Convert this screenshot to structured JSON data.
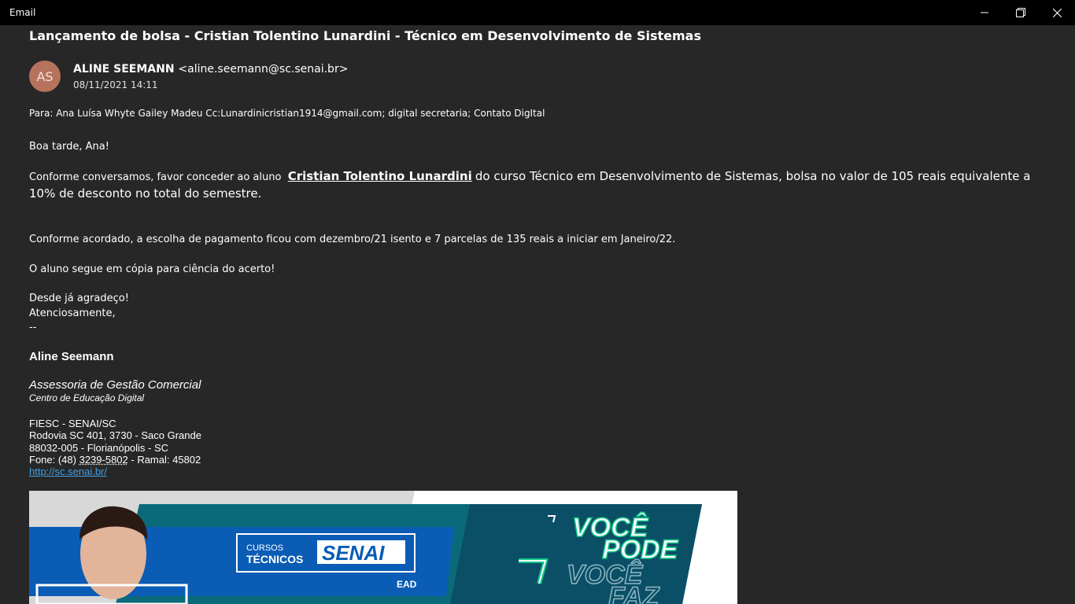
{
  "window": {
    "title": "Email",
    "controls": [
      "minimize-icon",
      "restore-icon",
      "close-icon"
    ]
  },
  "email": {
    "subject": "Lançamento de bolsa - Cristian Tolentino Lunardini - Técnico em Desenvolvimento de Sistemas",
    "avatar_initials": "AS",
    "avatar_color": "#b5735e",
    "sender_name": "ALINE SEEMANN",
    "sender_address": "<aline.seemann@sc.senai.br>",
    "date": "08/11/2021 14:11",
    "recipients": "Para: Ana Luísa Whyte Gailey Madeu Cc:Lunardinicristian1914@gmail.com; digital secretaria; Contato DigItal",
    "greeting": "Boa tarde, Ana!",
    "para1_prefix": "Conforme conversamos, favor conceder ao aluno",
    "para1_student": "Cristian Tolentino Lunardini",
    "para1_rest": "do curso Técnico em Desenvolvimento de Sistemas, bolsa no valor de 105 reais equivalente a 10% de desconto no total do semestre.",
    "para2": "Conforme acordado, a escolha de pagamento ficou com dezembro/21 isento e 7 parcelas de 135 reais a iniciar em Janeiro/22.",
    "para3": "O aluno segue em cópia para ciência do acerto!",
    "closing1": "Desde já agradeço!",
    "closing2": "Atenciosamente,",
    "sig_separator": "--"
  },
  "signature": {
    "name": "Aline Seemann",
    "role": "Assessoria de Gestão Comercial",
    "department": "Centro de Educação Digital",
    "org": "FIESC - SENAI/SC",
    "address1": "Rodovia SC 401, 3730 -  Saco Grande",
    "address2": "88032-005 - Florianópolis  -  SC",
    "phone_prefix": "Fone: (48) ",
    "phone_number": "3239-5802",
    "phone_suffix": " - Ramal: 45802",
    "link": "http://sc.senai.br/"
  },
  "banner": {
    "cursos": "CURSOS",
    "tecnicos": "TÉCNICOS",
    "brand": "SENAI",
    "ead": "EAD",
    "slogan1": "VOCÊ",
    "slogan2": "PODE",
    "slogan3": "VOCÊ",
    "slogan4": "FAZ",
    "colors": {
      "blue": "#0a5cb5",
      "teal": "#0b6a7a",
      "green": "#12c98a",
      "navy": "#0b2a4a"
    }
  }
}
